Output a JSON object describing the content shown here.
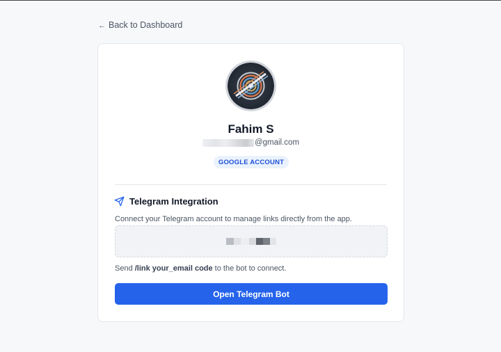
{
  "nav": {
    "back_label": "Back to Dashboard",
    "back_arrow": "←"
  },
  "profile": {
    "name": "Fahim S",
    "email_visible": "@gmail.com",
    "account_badge": "GOOGLE ACCOUNT",
    "avatar_icon": "abstract-swirl-avatar"
  },
  "telegram": {
    "icon": "paper-plane-icon",
    "title": "Telegram Integration",
    "description": "Connect your Telegram account to manage links directly from the app.",
    "hint_prefix": "Send ",
    "hint_command": "/link your_email code",
    "hint_suffix": " to the bot to connect.",
    "button_label": "Open Telegram Bot"
  },
  "colors": {
    "accent": "#2563eb",
    "badge_bg": "#eaf2fd",
    "badge_text": "#1d4ed8"
  }
}
